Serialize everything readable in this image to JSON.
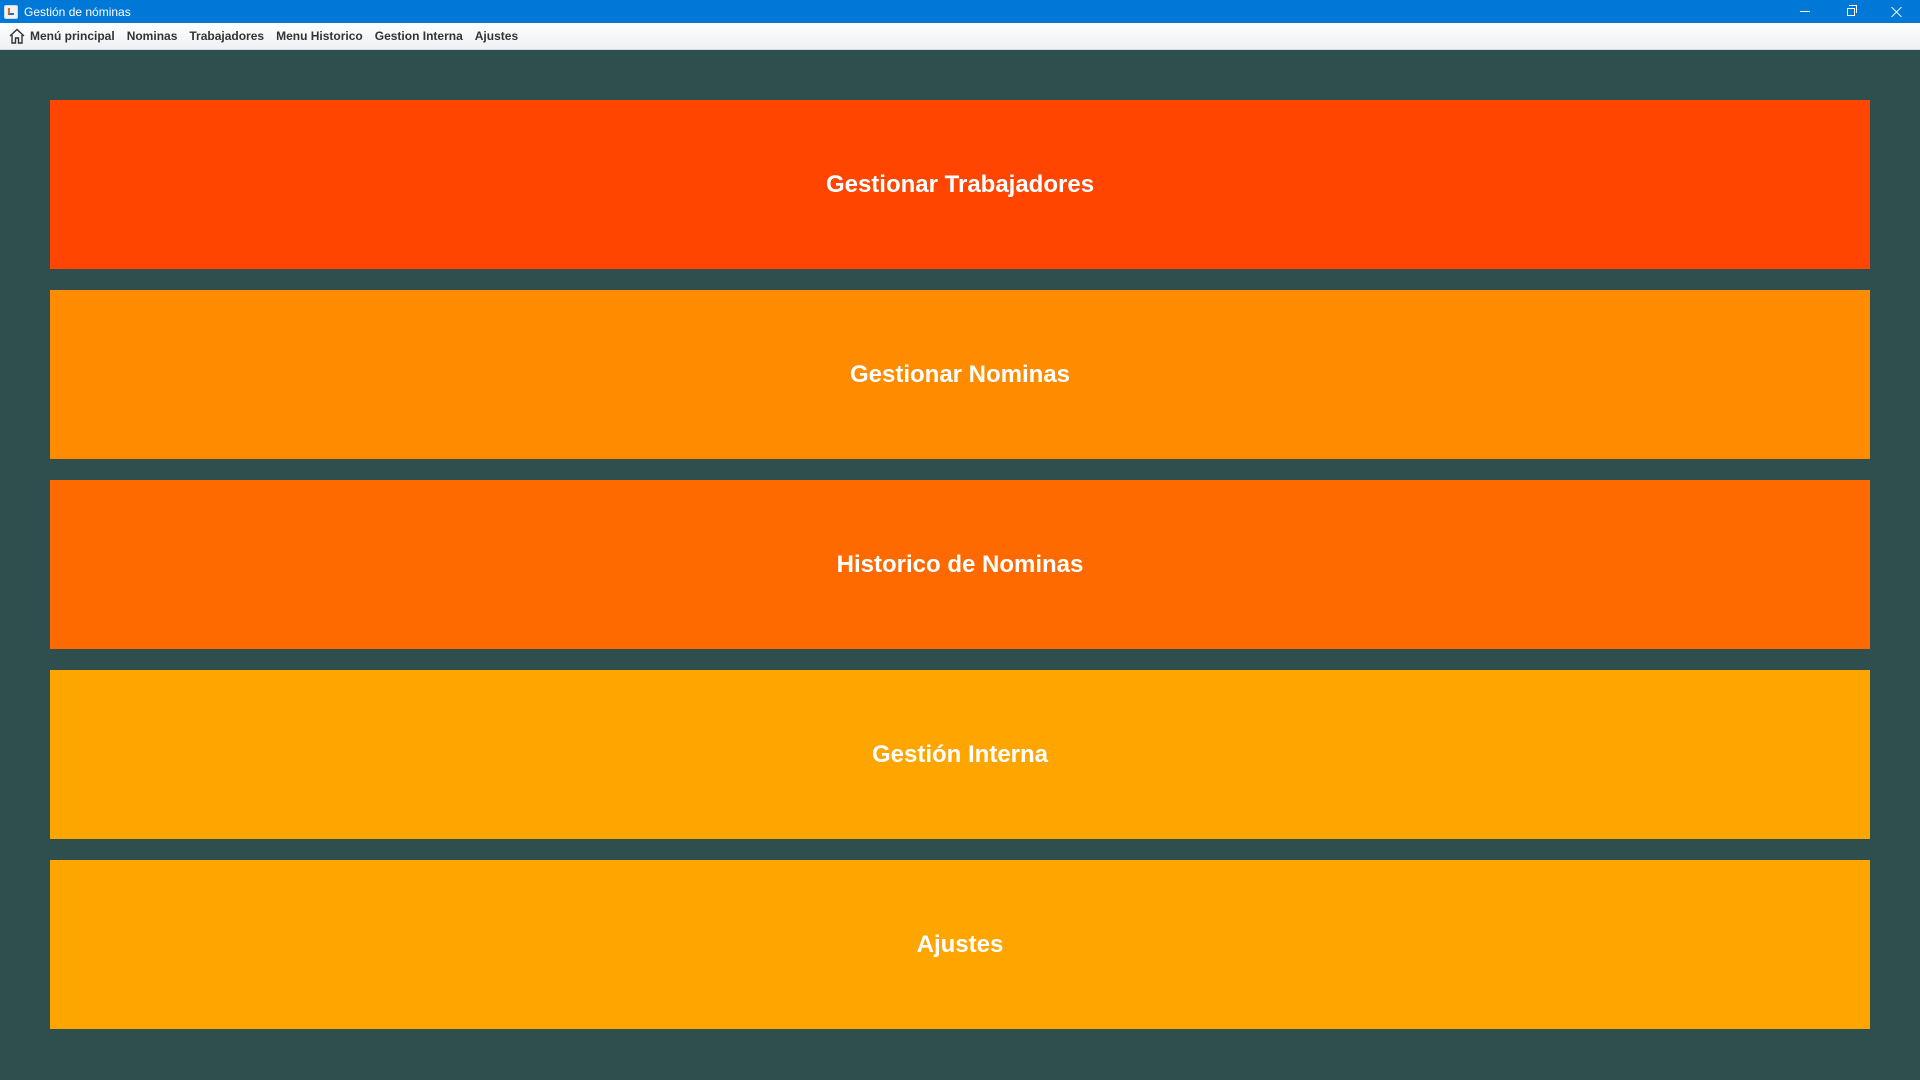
{
  "window": {
    "title": "Gestión de nóminas",
    "controls": {
      "minimize": "minimize-icon",
      "restore": "restore-icon",
      "close": "close-icon"
    }
  },
  "menubar": {
    "items": [
      {
        "label": "Menú principal",
        "icon": "home-icon"
      },
      {
        "label": "Nominas"
      },
      {
        "label": "Trabajadores"
      },
      {
        "label": "Menu Historico"
      },
      {
        "label": "Gestion Interna"
      },
      {
        "label": "Ajustes"
      }
    ]
  },
  "main": {
    "background": "#2f4f4f",
    "buttons": [
      {
        "label": "Gestionar Trabajadores",
        "color": "#ff4500"
      },
      {
        "label": "Gestionar Nominas",
        "color": "#ff8c00"
      },
      {
        "label": "Historico de Nominas",
        "color": "#ff6a00"
      },
      {
        "label": "Gestión Interna",
        "color": "#ffa500"
      },
      {
        "label": "Ajustes",
        "color": "#ffa500"
      }
    ]
  },
  "colors": {
    "titlebar": "#0078d7",
    "button_text": "#ffffff"
  }
}
